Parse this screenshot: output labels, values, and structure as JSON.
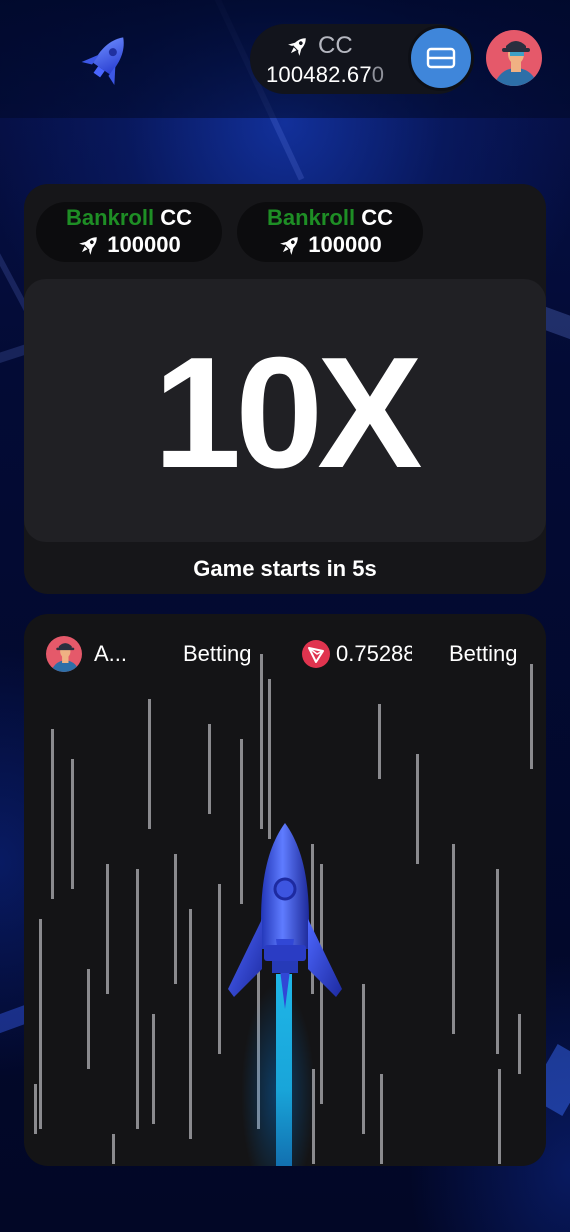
{
  "header": {
    "wallet": {
      "currency": "CC",
      "balance_main": "100482.67",
      "balance_tail": "0"
    }
  },
  "bankroll": [
    {
      "label": "Bankroll",
      "currency": "CC",
      "amount": "100000"
    },
    {
      "label": "Bankroll",
      "currency": "CC",
      "amount": "100000"
    }
  ],
  "game": {
    "multiplier": "10X",
    "status": "Game starts in 5s"
  },
  "bets": [
    {
      "player": "A...",
      "state": "Betting"
    },
    {
      "amount": "0.75288",
      "state": "Betting"
    }
  ],
  "colors": {
    "bankroll_green": "#1e8e25",
    "wallet_button": "#3f86da",
    "flame": "#1fb6e8",
    "tron_red": "#e0344f"
  },
  "icons": {
    "logo": "rocket-logo-icon",
    "wallet_currency": "rocket-icon",
    "wallet_button": "card-icon",
    "bet_currency": "tron-icon"
  }
}
